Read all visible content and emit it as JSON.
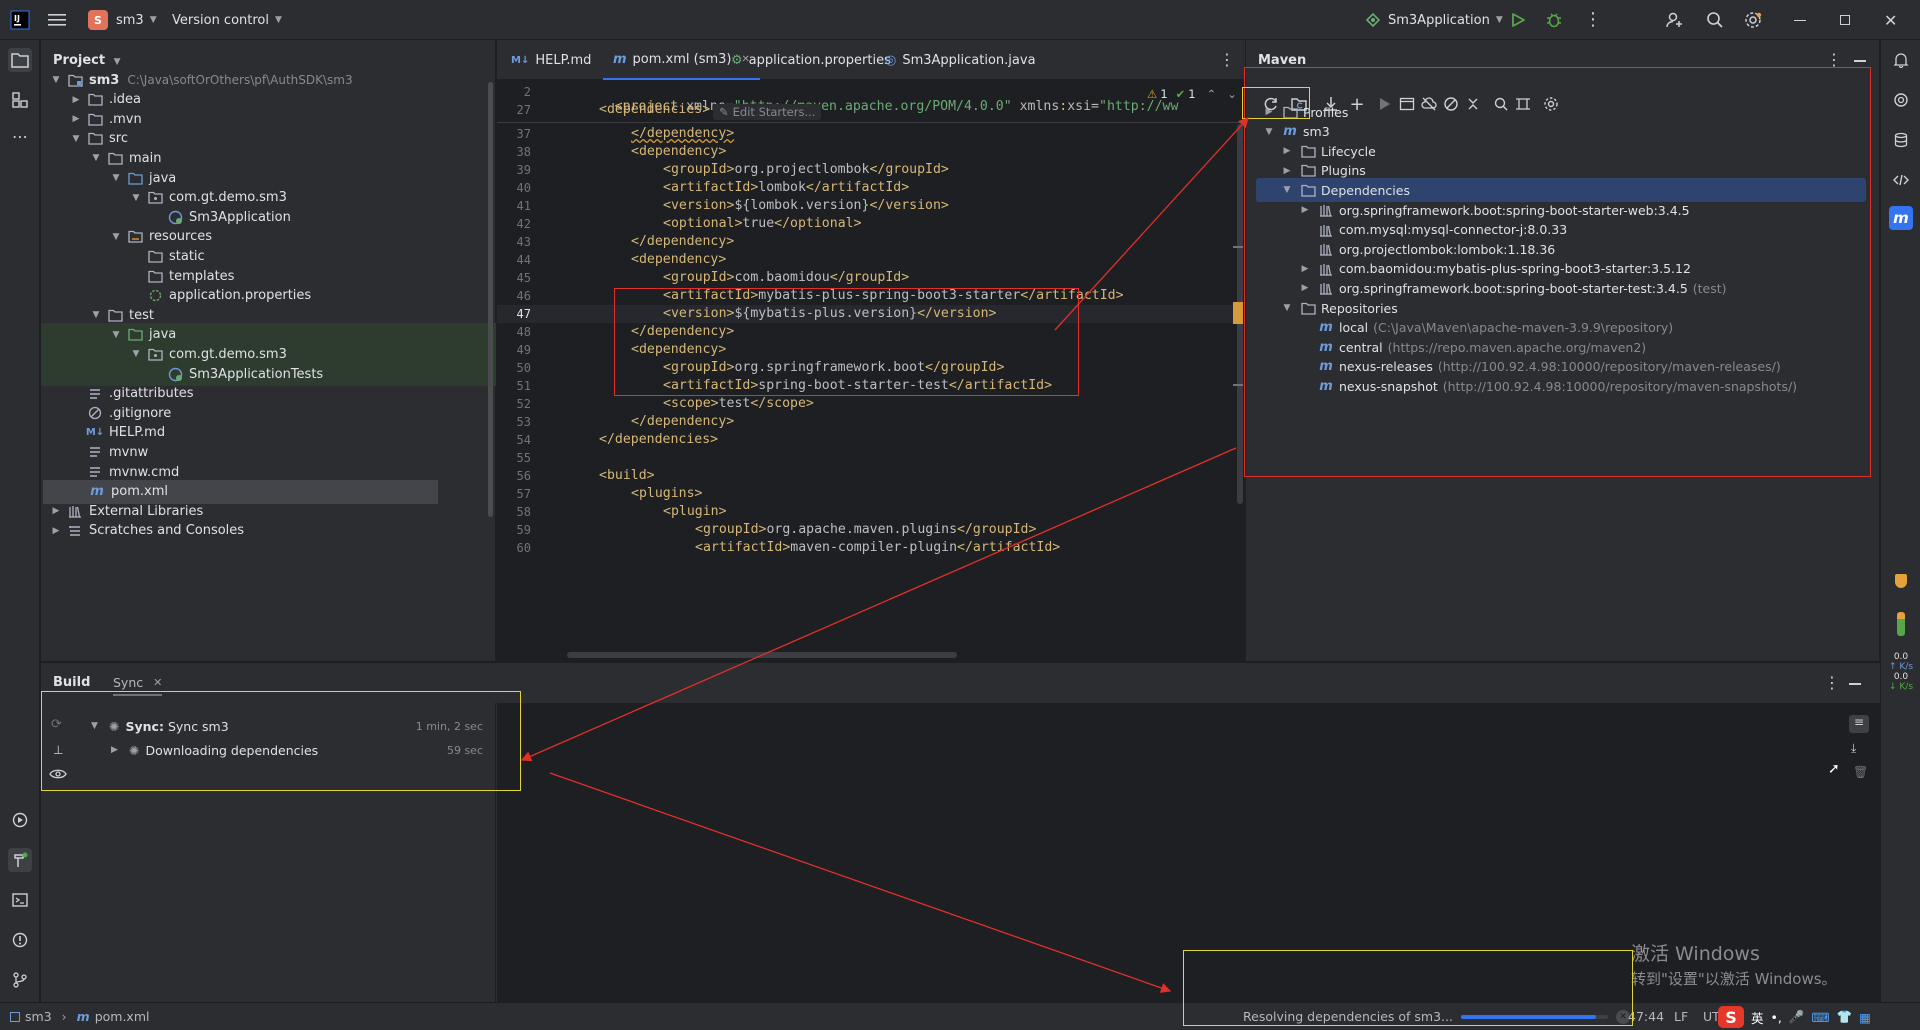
{
  "titlebar": {
    "project_badge": "S",
    "project_name": "sm3",
    "vcs": "Version control",
    "run_config": "Sm3Application"
  },
  "project_panel": {
    "title": "Project",
    "tree": [
      {
        "label": "sm3",
        "hint": "C:\\Java\\softOrOthers\\pf\\AuthSDK\\sm3",
        "depth": 0,
        "chev": "open",
        "icon": "module-folder-icon",
        "bold": true
      },
      {
        "label": ".idea",
        "depth": 1,
        "chev": "closed",
        "icon": "folder-icon"
      },
      {
        "label": ".mvn",
        "depth": 1,
        "chev": "closed",
        "icon": "folder-icon"
      },
      {
        "label": "src",
        "depth": 1,
        "chev": "open",
        "icon": "folder-icon"
      },
      {
        "label": "main",
        "depth": 2,
        "chev": "open",
        "icon": "folder-icon"
      },
      {
        "label": "java",
        "depth": 3,
        "chev": "open",
        "icon": "source-folder-icon"
      },
      {
        "label": "com.gt.demo.sm3",
        "depth": 4,
        "chev": "open",
        "icon": "package-icon"
      },
      {
        "label": "Sm3Application",
        "depth": 5,
        "chev": "none",
        "icon": "spring-class-icon"
      },
      {
        "label": "resources",
        "depth": 3,
        "chev": "open",
        "icon": "resources-folder-icon"
      },
      {
        "label": "static",
        "depth": 4,
        "chev": "none",
        "icon": "folder-icon"
      },
      {
        "label": "templates",
        "depth": 4,
        "chev": "none",
        "icon": "folder-icon"
      },
      {
        "label": "application.properties",
        "depth": 4,
        "chev": "none",
        "icon": "properties-icon"
      },
      {
        "label": "test",
        "depth": 2,
        "chev": "open",
        "icon": "folder-icon"
      },
      {
        "label": "java",
        "depth": 3,
        "chev": "open",
        "icon": "test-folder-icon",
        "hl": true
      },
      {
        "label": "com.gt.demo.sm3",
        "depth": 4,
        "chev": "open",
        "icon": "package-icon",
        "hl": true
      },
      {
        "label": "Sm3ApplicationTests",
        "depth": 5,
        "chev": "none",
        "icon": "spring-class-icon",
        "hl": true
      },
      {
        "label": ".gitattributes",
        "depth": 1,
        "chev": "none",
        "icon": "text-file-icon"
      },
      {
        "label": ".gitignore",
        "depth": 1,
        "chev": "none",
        "icon": "ignore-file-icon"
      },
      {
        "label": "HELP.md",
        "depth": 1,
        "chev": "none",
        "icon": "markdown-icon"
      },
      {
        "label": "mvnw",
        "depth": 1,
        "chev": "none",
        "icon": "text-file-icon"
      },
      {
        "label": "mvnw.cmd",
        "depth": 1,
        "chev": "none",
        "icon": "text-file-icon"
      },
      {
        "label": "pom.xml",
        "depth": 1,
        "chev": "none",
        "icon": "maven-file-icon",
        "selected": true
      },
      {
        "label": "External Libraries",
        "depth": 0,
        "chev": "closed",
        "icon": "library-icon"
      },
      {
        "label": "Scratches and Consoles",
        "depth": 0,
        "chev": "closed",
        "icon": "scratches-icon"
      }
    ]
  },
  "editor": {
    "tabs": [
      {
        "label": "HELP.md",
        "icon": "M↓",
        "active": false
      },
      {
        "label": "pom.xml (sm3)",
        "icon": "m",
        "active": true,
        "closable": true
      },
      {
        "label": "application.properties",
        "icon": "⚙",
        "active": false
      },
      {
        "label": "Sm3Application.java",
        "icon": "◎",
        "active": false
      }
    ],
    "sticky": [
      {
        "num": "2",
        "text": "<project xmlns=\"http://maven.apache.org/POM/4.0.0\" xmlns:xsi=\"http://ww"
      },
      {
        "num": "27",
        "text": "    <dependencies>"
      }
    ],
    "sticky_hint": "Edit Starters...",
    "inspections": {
      "warnings": "1",
      "ok": "1"
    },
    "lines": [
      {
        "num": "37",
        "indent": 8,
        "text": "</dependency>"
      },
      {
        "num": "38",
        "indent": 8,
        "text": "<dependency>"
      },
      {
        "num": "39",
        "indent": 12,
        "tag1": "<groupId>",
        "val": "org.projectlombok",
        "tag2": "</groupId>"
      },
      {
        "num": "40",
        "indent": 12,
        "tag1": "<artifactId>",
        "val": "lombok",
        "tag2": "</artifactId>"
      },
      {
        "num": "41",
        "indent": 12,
        "tag1": "<version>",
        "val": "${lombok.version}",
        "tag2": "</version>"
      },
      {
        "num": "42",
        "indent": 12,
        "tag1": "<optional>",
        "val": "true",
        "tag2": "</optional>"
      },
      {
        "num": "43",
        "indent": 8,
        "text": "</dependency>"
      },
      {
        "num": "44",
        "indent": 8,
        "text": "<dependency>"
      },
      {
        "num": "45",
        "indent": 12,
        "tag1": "<groupId>",
        "val": "com.baomidou",
        "tag2": "</groupId>"
      },
      {
        "num": "46",
        "indent": 12,
        "tag1": "<artifactId>",
        "val": "mybatis-plus-spring-boot3-starter",
        "tag2": "</artifactId>"
      },
      {
        "num": "47",
        "indent": 12,
        "tag1": "<version>",
        "val": "${mybatis-plus.version}",
        "tag2": "</version>",
        "current": true
      },
      {
        "num": "48",
        "indent": 8,
        "text": "</dependency>"
      },
      {
        "num": "49",
        "indent": 8,
        "text": "<dependency>"
      },
      {
        "num": "50",
        "indent": 12,
        "tag1": "<groupId>",
        "val": "org.springframework.boot",
        "tag2": "</groupId>"
      },
      {
        "num": "51",
        "indent": 12,
        "tag1": "<artifactId>",
        "val": "spring-boot-starter-test",
        "tag2": "</artifactId>"
      },
      {
        "num": "52",
        "indent": 12,
        "tag1": "<scope>",
        "val": "test",
        "tag2": "</scope>"
      },
      {
        "num": "53",
        "indent": 8,
        "text": "</dependency>"
      },
      {
        "num": "54",
        "indent": 4,
        "text": "</dependencies>"
      },
      {
        "num": "55",
        "indent": 0,
        "text": ""
      },
      {
        "num": "56",
        "indent": 4,
        "text": "<build>"
      },
      {
        "num": "57",
        "indent": 8,
        "text": "<plugins>"
      },
      {
        "num": "58",
        "indent": 12,
        "text": "<plugin>"
      },
      {
        "num": "59",
        "indent": 16,
        "tag1": "<groupId>",
        "val": "org.apache.maven.plugins",
        "tag2": "</groupId>"
      },
      {
        "num": "60",
        "indent": 16,
        "tag1": "<artifactId>",
        "val": "maven-compiler-plugin",
        "tag2": "</artifactId>"
      }
    ]
  },
  "maven": {
    "title": "Maven",
    "tree": [
      {
        "label": "Profiles",
        "depth": 0,
        "chev": "closed",
        "icon": "folder-icon"
      },
      {
        "label": "sm3",
        "depth": 0,
        "chev": "open",
        "icon": "maven-icon"
      },
      {
        "label": "Lifecycle",
        "depth": 1,
        "chev": "closed",
        "icon": "folder-icon"
      },
      {
        "label": "Plugins",
        "depth": 1,
        "chev": "closed",
        "icon": "folder-icon"
      },
      {
        "label": "Dependencies",
        "depth": 1,
        "chev": "open",
        "icon": "folder-icon",
        "selected": true
      },
      {
        "label": "org.springframework.boot:spring-boot-starter-web:3.4.5",
        "depth": 2,
        "chev": "closed",
        "icon": "library-icon"
      },
      {
        "label": "com.mysql:mysql-connector-j:8.0.33",
        "depth": 2,
        "chev": "none",
        "icon": "library-icon"
      },
      {
        "label": "org.projectlombok:lombok:1.18.36",
        "depth": 2,
        "chev": "none",
        "icon": "library-icon"
      },
      {
        "label": "com.baomidou:mybatis-plus-spring-boot3-starter:3.5.12",
        "depth": 2,
        "chev": "closed",
        "icon": "library-icon"
      },
      {
        "label": "org.springframework.boot:spring-boot-starter-test:3.4.5",
        "hint": "(test)",
        "depth": 2,
        "chev": "closed",
        "icon": "library-icon"
      },
      {
        "label": "Repositories",
        "depth": 1,
        "chev": "open",
        "icon": "folder-icon"
      },
      {
        "label": "local",
        "hint": "(C:\\Java\\Maven\\apache-maven-3.9.9\\repository)",
        "depth": 2,
        "chev": "none",
        "icon": "maven-icon"
      },
      {
        "label": "central",
        "hint": "(https://repo.maven.apache.org/maven2)",
        "depth": 2,
        "chev": "none",
        "icon": "maven-icon"
      },
      {
        "label": "nexus-releases",
        "hint": "(http://100.92.4.98:10000/repository/maven-releases/)",
        "depth": 2,
        "chev": "none",
        "icon": "maven-icon"
      },
      {
        "label": "nexus-snapshot",
        "hint": "(http://100.92.4.98:10000/repository/maven-snapshots/)",
        "depth": 2,
        "chev": "none",
        "icon": "maven-icon"
      }
    ]
  },
  "build": {
    "tab_build": "Build",
    "tab_sync": "Sync",
    "rows": [
      {
        "label_bold": "Sync:",
        "label": "Sync sm3",
        "time": "1 min, 2 sec"
      },
      {
        "label_bold": "",
        "label": "Downloading dependencies",
        "time": "59 sec"
      }
    ]
  },
  "status": {
    "breadcrumb_project": "sm3",
    "breadcrumb_file": "pom.xml",
    "progress_text": "Resolving dependencies of sm3...",
    "progress": 0.92,
    "position": "47:44",
    "line_sep": "LF",
    "encoding": "UT"
  },
  "watermark": {
    "line1": "激活 Windows",
    "line2": "转到\"设置\"以激活 Windows。"
  },
  "net": {
    "up": "0.0",
    "up_unit": "K/s",
    "down": "0.0",
    "down_unit": "K/s"
  },
  "ime": {
    "label": "英"
  },
  "colors": {
    "accent": "#3574f0",
    "annotation_red": "#e0302a",
    "annotation_yellow": "#e2d33a"
  }
}
